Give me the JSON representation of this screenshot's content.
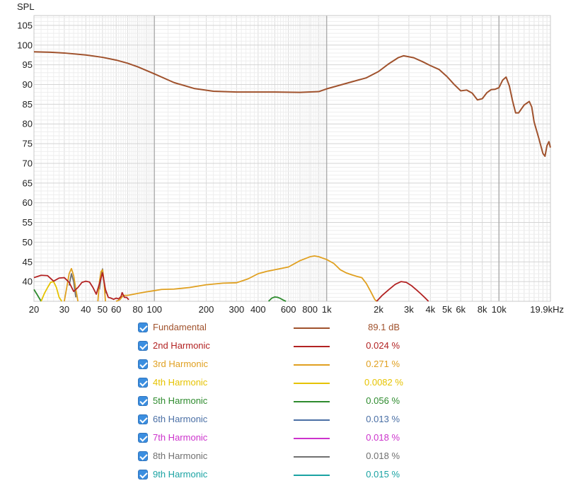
{
  "chart_data": {
    "type": "line",
    "ylabel": "SPL",
    "xscale": "log",
    "xlim": [
      20,
      19900
    ],
    "ylim": [
      35,
      107.5
    ],
    "grid": true,
    "y_ticks": [
      40,
      45,
      50,
      55,
      60,
      65,
      70,
      75,
      80,
      85,
      90,
      95,
      100,
      105
    ],
    "x_ticks": [
      {
        "v": 20,
        "label": "20"
      },
      {
        "v": 30,
        "label": "30"
      },
      {
        "v": 40,
        "label": "40"
      },
      {
        "v": 50,
        "label": "50"
      },
      {
        "v": 60,
        "label": "60"
      },
      {
        "v": 80,
        "label": "80"
      },
      {
        "v": 100,
        "label": "100"
      },
      {
        "v": 200,
        "label": "200"
      },
      {
        "v": 300,
        "label": "300"
      },
      {
        "v": 400,
        "label": "400"
      },
      {
        "v": 600,
        "label": "600"
      },
      {
        "v": 800,
        "label": "800"
      },
      {
        "v": 1000,
        "label": "1k"
      },
      {
        "v": 2000,
        "label": "2k"
      },
      {
        "v": 3000,
        "label": "3k"
      },
      {
        "v": 4000,
        "label": "4k"
      },
      {
        "v": 5000,
        "label": "5k"
      },
      {
        "v": 6000,
        "label": "6k"
      },
      {
        "v": 8000,
        "label": "8k"
      },
      {
        "v": 10000,
        "label": "10k"
      },
      {
        "v": 19900,
        "label": "19.9kHz"
      }
    ],
    "series": [
      {
        "name": "Fundamental",
        "value": "89.1 dB",
        "color": "#a0522d",
        "points": [
          [
            20,
            98.3
          ],
          [
            25,
            98.2
          ],
          [
            30,
            98.0
          ],
          [
            40,
            97.5
          ],
          [
            50,
            96.9
          ],
          [
            60,
            96.2
          ],
          [
            70,
            95.4
          ],
          [
            80,
            94.5
          ],
          [
            100,
            92.7
          ],
          [
            130,
            90.5
          ],
          [
            170,
            89
          ],
          [
            220,
            88.3
          ],
          [
            300,
            88.1
          ],
          [
            500,
            88.1
          ],
          [
            700,
            88
          ],
          [
            900,
            88.2
          ],
          [
            1000,
            88.9
          ],
          [
            1300,
            90.3
          ],
          [
            1700,
            91.7
          ],
          [
            2000,
            93.3
          ],
          [
            2300,
            95.3
          ],
          [
            2600,
            96.8
          ],
          [
            2800,
            97.3
          ],
          [
            3200,
            96.8
          ],
          [
            3600,
            95.8
          ],
          [
            4000,
            94.8
          ],
          [
            4500,
            93.8
          ],
          [
            5000,
            92
          ],
          [
            5500,
            90
          ],
          [
            6000,
            88.4
          ],
          [
            6500,
            88.6
          ],
          [
            7000,
            87.8
          ],
          [
            7500,
            86.1
          ],
          [
            8000,
            86.4
          ],
          [
            8500,
            87.9
          ],
          [
            9000,
            88.7
          ],
          [
            9500,
            88.8
          ],
          [
            10000,
            89.2
          ],
          [
            10500,
            91.1
          ],
          [
            11000,
            91.9
          ],
          [
            11500,
            89.6
          ],
          [
            12000,
            85.8
          ],
          [
            12500,
            82.8
          ],
          [
            13000,
            82.8
          ],
          [
            14000,
            84.8
          ],
          [
            15000,
            85.7
          ],
          [
            15500,
            84.3
          ],
          [
            16000,
            80.5
          ],
          [
            17000,
            76.5
          ],
          [
            18000,
            72.5
          ],
          [
            18500,
            71.8
          ],
          [
            19000,
            74.5
          ],
          [
            19500,
            75.5
          ],
          [
            19900,
            74
          ]
        ]
      },
      {
        "name": "2nd Harmonic",
        "value": "0.024 %",
        "color": "#b22222",
        "segments": [
          [
            [
              20,
              41
            ],
            [
              22,
              41.6
            ],
            [
              24,
              41.5
            ],
            [
              26,
              40.1
            ],
            [
              28,
              40.9
            ],
            [
              30,
              41
            ],
            [
              32,
              39.8
            ],
            [
              34,
              37.5
            ],
            [
              36,
              38.5
            ],
            [
              38,
              39.8
            ],
            [
              40,
              40.1
            ],
            [
              42,
              39.9
            ],
            [
              44,
              38.5
            ],
            [
              46,
              36.8
            ],
            [
              48,
              39.5
            ],
            [
              50,
              42.2
            ],
            [
              52,
              38
            ],
            [
              54,
              36
            ],
            [
              56,
              35.8
            ],
            [
              58,
              35.5
            ],
            [
              60,
              35.8
            ],
            [
              62,
              35.6
            ],
            [
              64,
              36.2
            ],
            [
              65,
              37.2
            ],
            [
              67,
              36
            ],
            [
              69,
              36
            ],
            [
              71,
              35.4
            ]
          ],
          [
            [
              1950,
              35
            ],
            [
              2100,
              36.5
            ],
            [
              2300,
              38
            ],
            [
              2500,
              39.3
            ],
            [
              2700,
              40
            ],
            [
              2900,
              39.8
            ],
            [
              3100,
              39
            ],
            [
              3300,
              38
            ],
            [
              3500,
              37
            ],
            [
              3700,
              36
            ],
            [
              3900,
              35
            ]
          ]
        ]
      },
      {
        "name": "3rd Harmonic",
        "value": "0.271 %",
        "color": "#e0a020",
        "segments": [
          [
            [
              30,
              35
            ],
            [
              31,
              38.5
            ],
            [
              32,
              42
            ],
            [
              33,
              43.3
            ],
            [
              34,
              41.5
            ],
            [
              35,
              38
            ],
            [
              36,
              35
            ]
          ],
          [
            [
              47,
              35
            ],
            [
              48,
              40
            ],
            [
              49,
              42.5
            ],
            [
              50,
              43
            ],
            [
              51,
              40
            ],
            [
              52,
              35
            ]
          ],
          [
            [
              60,
              35
            ],
            [
              63,
              35.4
            ],
            [
              66,
              36.5
            ],
            [
              70,
              36.5
            ],
            [
              80,
              37
            ],
            [
              90,
              37.4
            ],
            [
              100,
              37.7
            ],
            [
              110,
              38
            ],
            [
              130,
              38.1
            ],
            [
              160,
              38.5
            ],
            [
              200,
              39.2
            ],
            [
              250,
              39.6
            ],
            [
              300,
              39.7
            ],
            [
              350,
              40.7
            ],
            [
              400,
              42
            ],
            [
              450,
              42.6
            ],
            [
              500,
              43
            ],
            [
              600,
              43.7
            ],
            [
              700,
              45.3
            ],
            [
              800,
              46.3
            ],
            [
              850,
              46.5
            ],
            [
              900,
              46.3
            ],
            [
              1000,
              45.6
            ],
            [
              1100,
              44.6
            ],
            [
              1200,
              43
            ],
            [
              1300,
              42.2
            ],
            [
              1400,
              41.7
            ],
            [
              1500,
              41.3
            ],
            [
              1600,
              41
            ],
            [
              1700,
              39.5
            ],
            [
              1800,
              37.5
            ],
            [
              1900,
              35.5
            ],
            [
              1950,
              35
            ]
          ]
        ]
      },
      {
        "name": "4th Harmonic",
        "value": "0.0082 %",
        "color": "#e6c300",
        "segments": [
          [
            [
              22,
              35
            ],
            [
              23,
              37
            ],
            [
              24,
              38.5
            ],
            [
              25,
              39.8
            ],
            [
              26,
              40
            ],
            [
              27,
              38.5
            ],
            [
              28,
              36
            ],
            [
              29,
              35
            ]
          ]
        ]
      },
      {
        "name": "5th Harmonic",
        "value": "0.056 %",
        "color": "#2e8b2e",
        "segments": [
          [
            [
              20,
              38
            ],
            [
              21,
              36.5
            ],
            [
              22,
              35
            ]
          ],
          [
            [
              460,
              35
            ],
            [
              480,
              35.8
            ],
            [
              500,
              36.1
            ],
            [
              520,
              36
            ],
            [
              540,
              35.7
            ],
            [
              560,
              35.3
            ],
            [
              580,
              35
            ]
          ]
        ]
      },
      {
        "name": "6th Harmonic",
        "value": "0.013 %",
        "color": "#4a6fa5",
        "segments": []
      },
      {
        "name": "7th Harmonic",
        "value": "0.018 %",
        "color": "#cc33cc",
        "segments": []
      },
      {
        "name": "8th Harmonic",
        "value": "0.018 %",
        "color": "#707070",
        "segments": [
          [
            [
              32,
              39
            ],
            [
              33,
              42
            ],
            [
              34,
              40
            ],
            [
              35,
              36
            ]
          ],
          [
            [
              48,
              38
            ],
            [
              49,
              41
            ],
            [
              50,
              43.2
            ],
            [
              51,
              40
            ],
            [
              52,
              37
            ]
          ]
        ]
      },
      {
        "name": "9th Harmonic",
        "value": "0.015 %",
        "color": "#1aa3a3",
        "segments": []
      }
    ]
  },
  "legend_items": [
    {
      "name": "Fundamental",
      "value": "89.1 dB",
      "color": "#a0522d"
    },
    {
      "name": "2nd Harmonic",
      "value": "0.024 %",
      "color": "#b22222"
    },
    {
      "name": "3rd Harmonic",
      "value": "0.271 %",
      "color": "#e0a020"
    },
    {
      "name": "4th Harmonic",
      "value": "0.0082 %",
      "color": "#e6c300"
    },
    {
      "name": "5th Harmonic",
      "value": "0.056 %",
      "color": "#2e8b2e"
    },
    {
      "name": "6th Harmonic",
      "value": "0.013 %",
      "color": "#4a6fa5"
    },
    {
      "name": "7th Harmonic",
      "value": "0.018 %",
      "color": "#cc33cc"
    },
    {
      "name": "8th Harmonic",
      "value": "0.018 %",
      "color": "#707070"
    },
    {
      "name": "9th Harmonic",
      "value": "0.015 %",
      "color": "#1aa3a3"
    }
  ]
}
